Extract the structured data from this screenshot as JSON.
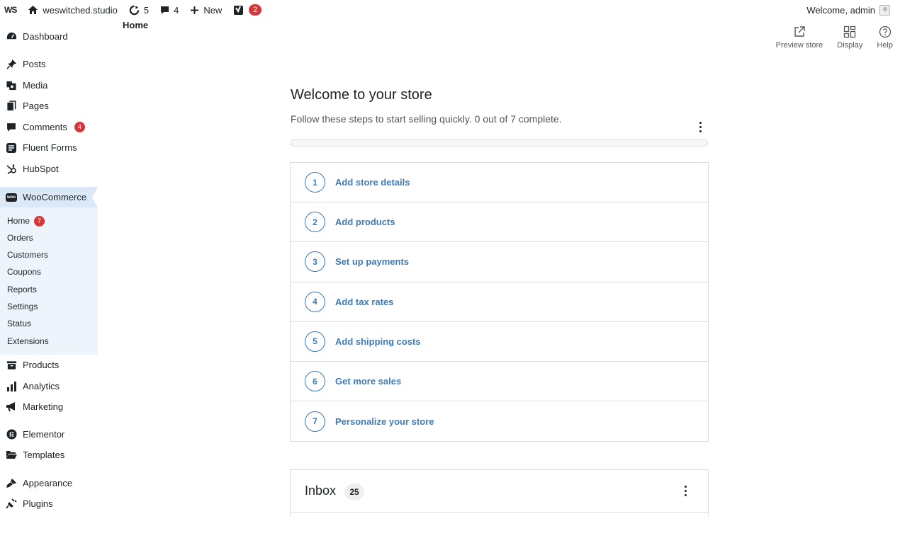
{
  "adminbar": {
    "logo": "WS",
    "site_name": "weswitched.studio",
    "updates_count": "5",
    "comments_count": "4",
    "new_label": "New",
    "yoast_badge": "2",
    "welcome": "Welcome, admin"
  },
  "sidebar": {
    "items": [
      {
        "label": "Dashboard",
        "icon": "dashboard-icon"
      },
      {
        "label": "Posts",
        "icon": "pin-icon"
      },
      {
        "label": "Media",
        "icon": "media-icon"
      },
      {
        "label": "Pages",
        "icon": "pages-icon"
      },
      {
        "label": "Comments",
        "icon": "comment-icon",
        "badge": "4"
      },
      {
        "label": "Fluent Forms",
        "icon": "forms-icon"
      },
      {
        "label": "HubSpot",
        "icon": "hubspot-icon"
      },
      {
        "label": "WooCommerce",
        "icon": "woo-icon"
      },
      {
        "label": "Products",
        "icon": "archive-icon"
      },
      {
        "label": "Analytics",
        "icon": "bar-chart-icon"
      },
      {
        "label": "Marketing",
        "icon": "megaphone-icon"
      },
      {
        "label": "Elementor",
        "icon": "elementor-icon"
      },
      {
        "label": "Templates",
        "icon": "folder-icon"
      },
      {
        "label": "Appearance",
        "icon": "brush-icon"
      },
      {
        "label": "Plugins",
        "icon": "plugin-icon"
      }
    ],
    "woo_submenu": [
      {
        "label": "Home",
        "badge": "7"
      },
      {
        "label": "Orders"
      },
      {
        "label": "Customers"
      },
      {
        "label": "Coupons"
      },
      {
        "label": "Reports"
      },
      {
        "label": "Settings"
      },
      {
        "label": "Status"
      },
      {
        "label": "Extensions"
      }
    ]
  },
  "header": {
    "page_title": "Home",
    "actions": [
      {
        "label": "Preview store",
        "icon": "external-link-icon"
      },
      {
        "label": "Display",
        "icon": "layout-icon"
      },
      {
        "label": "Help",
        "icon": "help-icon"
      }
    ]
  },
  "setup": {
    "title": "Welcome to your store",
    "subtitle": "Follow these steps to start selling quickly. 0 out of 7 complete.",
    "progress": 0,
    "tasks": [
      {
        "num": "1",
        "label": "Add store details"
      },
      {
        "num": "2",
        "label": "Add products"
      },
      {
        "num": "3",
        "label": "Set up payments"
      },
      {
        "num": "4",
        "label": "Add tax rates"
      },
      {
        "num": "5",
        "label": "Add shipping costs"
      },
      {
        "num": "6",
        "label": "Get more sales"
      },
      {
        "num": "7",
        "label": "Personalize your store"
      }
    ]
  },
  "inbox": {
    "title": "Inbox",
    "count": "25"
  }
}
